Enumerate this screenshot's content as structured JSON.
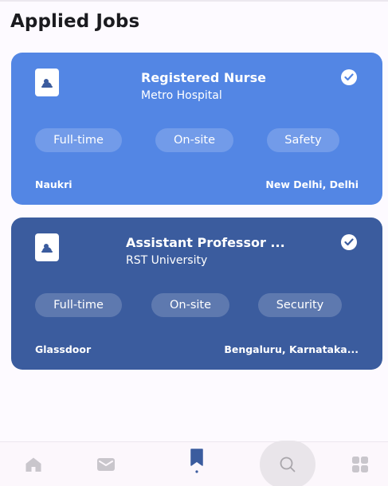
{
  "page": {
    "title": "Applied Jobs"
  },
  "jobs": [
    {
      "title": "Registered Nurse",
      "company": "Metro Hospital",
      "tags": [
        "Full-time",
        "On-site",
        "Safety"
      ],
      "source": "Naukri",
      "location": "New Delhi, Delhi",
      "card_color": "#5386e4",
      "logo_icon": "company-logo-icon",
      "status_icon": "check-circle-icon"
    },
    {
      "title": "Assistant Professor ...",
      "company": "RST University",
      "tags": [
        "Full-time",
        "On-site",
        "Security"
      ],
      "source": "Glassdoor",
      "location": "Bengaluru, Karnataka...",
      "card_color": "#3b5c9e",
      "logo_icon": "company-logo-icon",
      "status_icon": "check-circle-icon"
    }
  ],
  "nav": {
    "items": [
      {
        "icon": "home-icon",
        "active": false
      },
      {
        "icon": "mail-icon",
        "active": false
      },
      {
        "icon": "bookmark-icon",
        "active": true
      },
      {
        "icon": "search-icon",
        "active": false
      },
      {
        "icon": "grid-icon",
        "active": false
      }
    ],
    "active_color": "#3b5c9e",
    "inactive_color": "#c9c6cc"
  }
}
